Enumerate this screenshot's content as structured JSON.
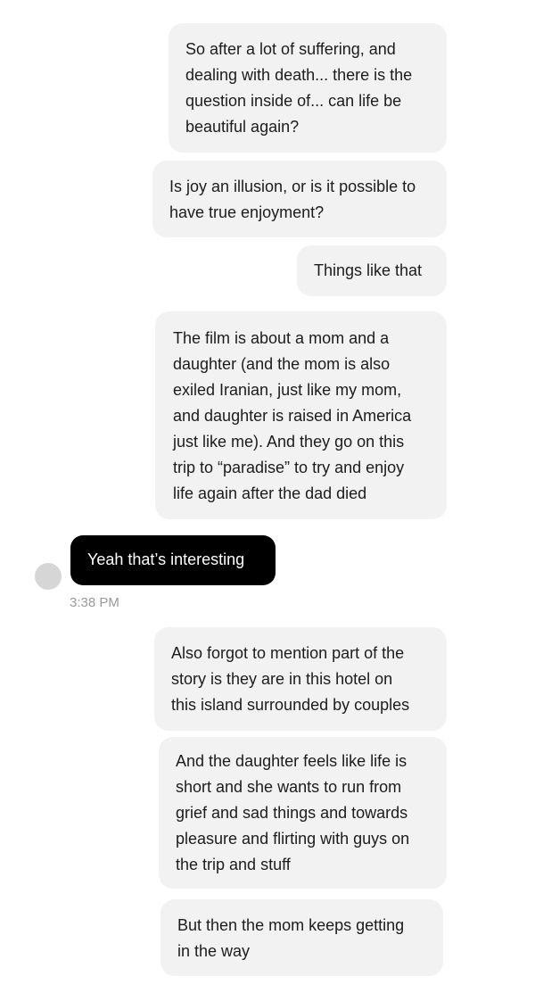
{
  "messages": [
    {
      "direction": "sent",
      "text": "So after a lot of suffering, and\ndealing with death... there is the\nquestion inside of... can life be\nbeautiful again?"
    },
    {
      "direction": "sent",
      "text": "Is joy an illusion, or is it possible to\nhave true enjoyment?"
    },
    {
      "direction": "sent",
      "text": "Things like that"
    },
    {
      "direction": "sent",
      "text": "The film is about a mom and a\ndaughter (and the mom is also\nexiled Iranian, just like my mom,\nand daughter is raised in America\njust like me). And they go on this\ntrip to “paradise” to try and enjoy\nlife again after the dad died"
    },
    {
      "direction": "received",
      "text": "Yeah that’s interesting",
      "timestamp": "3:38 PM"
    },
    {
      "direction": "sent",
      "text": "Also forgot to mention part of the\nstory is they are in this hotel on\nthis island surrounded by couples"
    },
    {
      "direction": "sent",
      "text": "And the daughter feels like life is\nshort and she wants to run from\ngrief and sad things and towards\npleasure and flirting with guys on\nthe trip and stuff"
    },
    {
      "direction": "sent",
      "text": "But then the mom keeps getting\nin the way"
    }
  ]
}
